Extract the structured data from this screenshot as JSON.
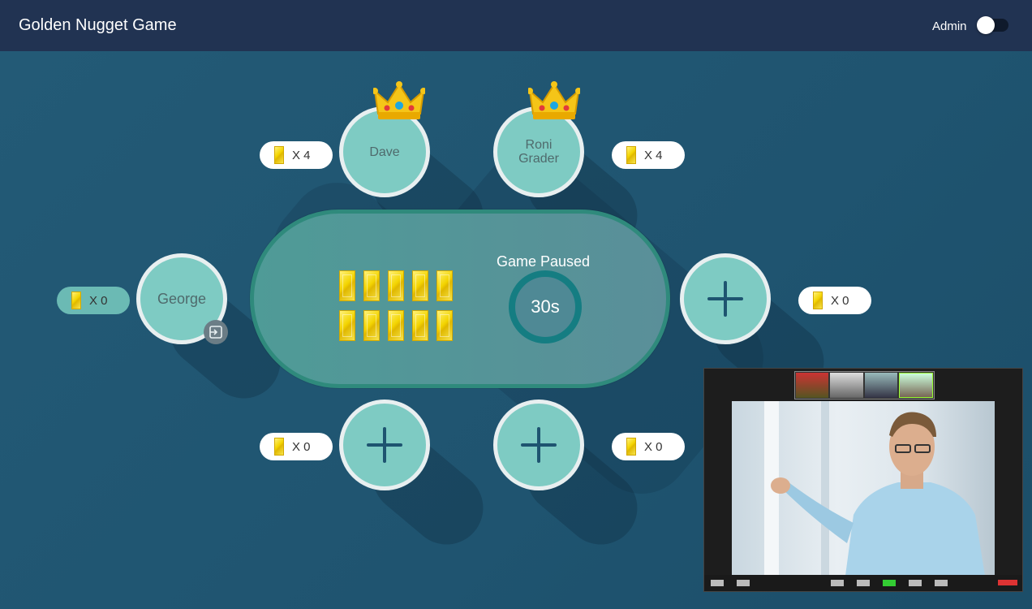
{
  "header": {
    "title": "Golden Nugget Game",
    "admin_label": "Admin",
    "admin_toggle_on": false
  },
  "table": {
    "gold_bars": 10,
    "status": "Game Paused",
    "timer": "30s"
  },
  "seats": [
    {
      "id": "dave",
      "name": "Dave",
      "crown": true,
      "count": "X 4"
    },
    {
      "id": "roni",
      "name": "Roni\nGrader",
      "crown": true,
      "count": "X 4"
    },
    {
      "id": "george",
      "name": "George",
      "crown": false,
      "count": "X 0",
      "active": true
    },
    {
      "id": "right-empty",
      "name": "",
      "empty": true,
      "count": "X 0"
    },
    {
      "id": "bottom-left-empty",
      "name": "",
      "empty": true,
      "count": "X 0"
    },
    {
      "id": "bottom-right-empty",
      "name": "",
      "empty": true,
      "count": "X 0"
    }
  ],
  "colors": {
    "header": "#213352",
    "background": "#1e5470",
    "seat": "#7ecbc3",
    "table": "#4f9b97",
    "gold": "#f3d400",
    "timer_ring": "#157d82"
  },
  "icons": {
    "crown": "crown-icon",
    "plus": "plus-icon",
    "exit": "exit-icon",
    "gold_bar": "gold-bar-icon"
  }
}
